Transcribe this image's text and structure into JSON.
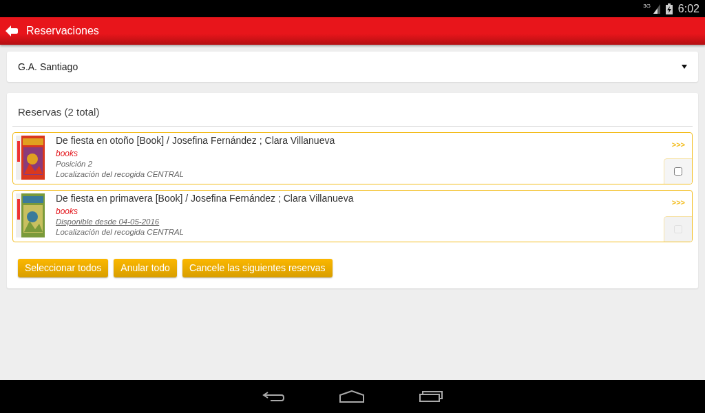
{
  "status_bar": {
    "network": "3G",
    "time": "6:02"
  },
  "app_bar": {
    "title": "Reservaciones"
  },
  "branch_select": {
    "value": "G.A. Santiago"
  },
  "reservations": {
    "heading": "Reservas (2 total)",
    "items": [
      {
        "title": "De fiesta en otoño [Book] / Josefina Fernández ; Clara Villanueva",
        "format": "books",
        "status": {
          "kind": "position",
          "text": "Posición 2"
        },
        "pickup": "Localización del recogida CENTRAL",
        "more": ">>>",
        "checked": false,
        "disabled": false
      },
      {
        "title": "De fiesta en primavera [Book] / Josefina Fernández ; Clara Villanueva",
        "format": "books",
        "status": {
          "kind": "available",
          "text": "Disponible desde 04-05-2016"
        },
        "pickup": "Localización del recogida CENTRAL",
        "more": ">>>",
        "checked": false,
        "disabled": true
      }
    ],
    "buttons": [
      "Seleccionar todos",
      "Anular todo",
      "Cancele las siguientes reservas"
    ]
  }
}
